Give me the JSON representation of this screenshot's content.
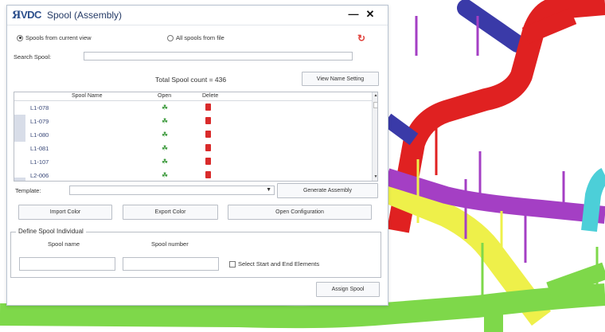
{
  "window": {
    "logo_text": "VDC",
    "logo_mark": "Я",
    "title": "Spool (Assembly)"
  },
  "titlebar": {
    "minimize_icon": "minimize-icon",
    "close_icon": "close-icon",
    "minimize_glyph": "—",
    "close_glyph": "✕"
  },
  "source": {
    "option_current": "Spools from current view",
    "option_file": "All spools from file",
    "selected": "option_current",
    "refresh_glyph": "↻"
  },
  "search": {
    "label": "Search Spool:",
    "value": ""
  },
  "total": {
    "text": "Total Spool count = 436"
  },
  "buttons": {
    "view_name_setting": "View Name Setting",
    "generate_assembly": "Generate Assembly",
    "import_color": "Import Color",
    "export_color": "Export Color",
    "open_configuration": "Open Configuration",
    "assign_spool": "Assign Spool"
  },
  "grid": {
    "columns": [
      "Spool Name",
      "Open",
      "Delete"
    ],
    "rows": [
      {
        "name": "L1-078"
      },
      {
        "name": "L1-079"
      },
      {
        "name": "L1-080"
      },
      {
        "name": "L1-081"
      },
      {
        "name": "L1-107"
      },
      {
        "name": "L2-006"
      }
    ]
  },
  "template": {
    "label": "Template:",
    "value": ""
  },
  "define": {
    "legend": "Define Spool Individual",
    "spool_name_label": "Spool name",
    "spool_number_label": "Spool number",
    "spool_name_value": "",
    "spool_number_value": "",
    "select_checkbox_label": "Select Start and End Elements"
  },
  "colors": {
    "accent": "#2c4f8c",
    "delete": "#d92b2b",
    "open": "#3c9a3c",
    "pipe_red": "#e02121",
    "pipe_yellow": "#eef04a",
    "pipe_purple": "#a43fc4",
    "pipe_green": "#7ed84a",
    "pipe_cyan": "#4ccfd8",
    "pipe_blue": "#3a3aa8"
  }
}
